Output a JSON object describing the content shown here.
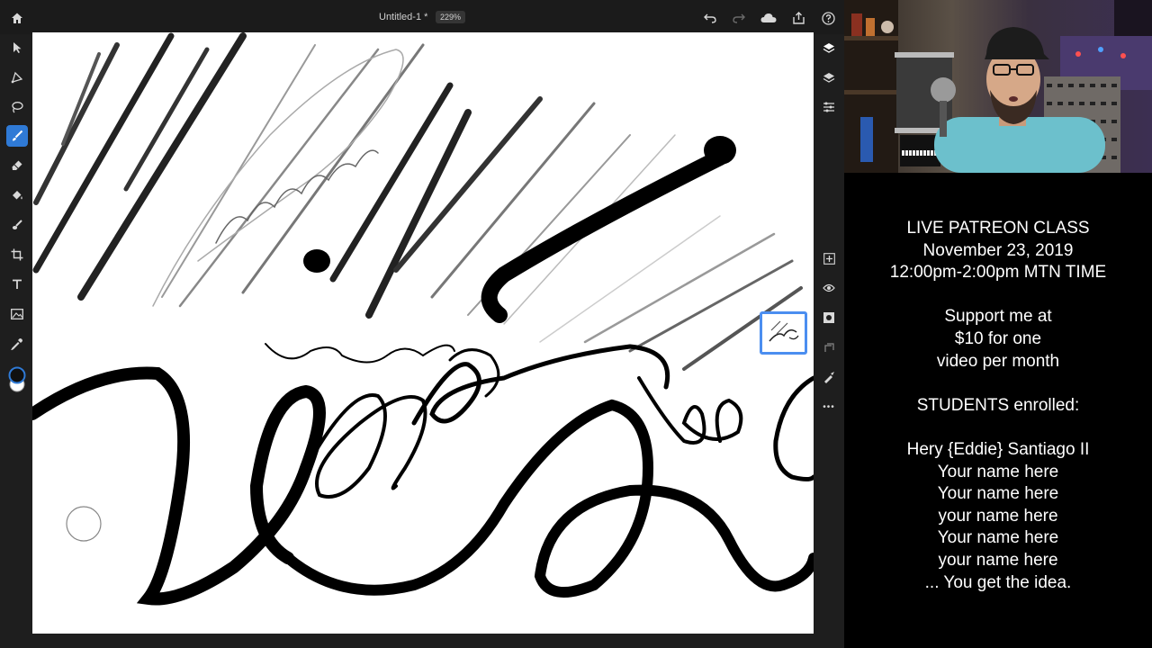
{
  "app": {
    "document_title": "Untitled-1 *",
    "zoom_level": "229%",
    "brush_size": "40"
  },
  "icons": {
    "top_left": [
      "home-icon"
    ],
    "top_right": [
      "undo-icon",
      "redo-icon",
      "cloud-icon",
      "share-icon",
      "help-icon"
    ],
    "left_toolbar": [
      "select-icon",
      "transform-icon",
      "lasso-icon",
      "paint-brush-icon",
      "eraser-icon",
      "fill-icon",
      "smudge-icon",
      "crop-icon",
      "text-icon",
      "image-icon",
      "eyedropper-icon",
      "color-swatch-icon"
    ],
    "right_toolbar": [
      "layers-icon",
      "layer-properties-icon",
      "adjustments-icon",
      "add-layer-icon",
      "visibility-icon",
      "mask-icon",
      "clipping-icon",
      "paint-adjust-icon",
      "more-icon"
    ]
  },
  "colors": {
    "accent": "#2f7ad6",
    "stroke": "#000000",
    "background_panel": "#1e1e1e"
  },
  "class_info": {
    "title": "LIVE PATREON CLASS",
    "date": "November 23, 2019",
    "time": "12:00pm-2:00pm MTN TIME",
    "support_line_1": "Support me at",
    "support_line_2": "$10 for one",
    "support_line_3": "video per month",
    "students_heading": "STUDENTS enrolled:",
    "students": [
      "Hery {Eddie} Santiago II",
      "Your name here",
      "Your name here",
      "your name here",
      "Your name here",
      "your name here",
      "... You get the idea."
    ]
  }
}
